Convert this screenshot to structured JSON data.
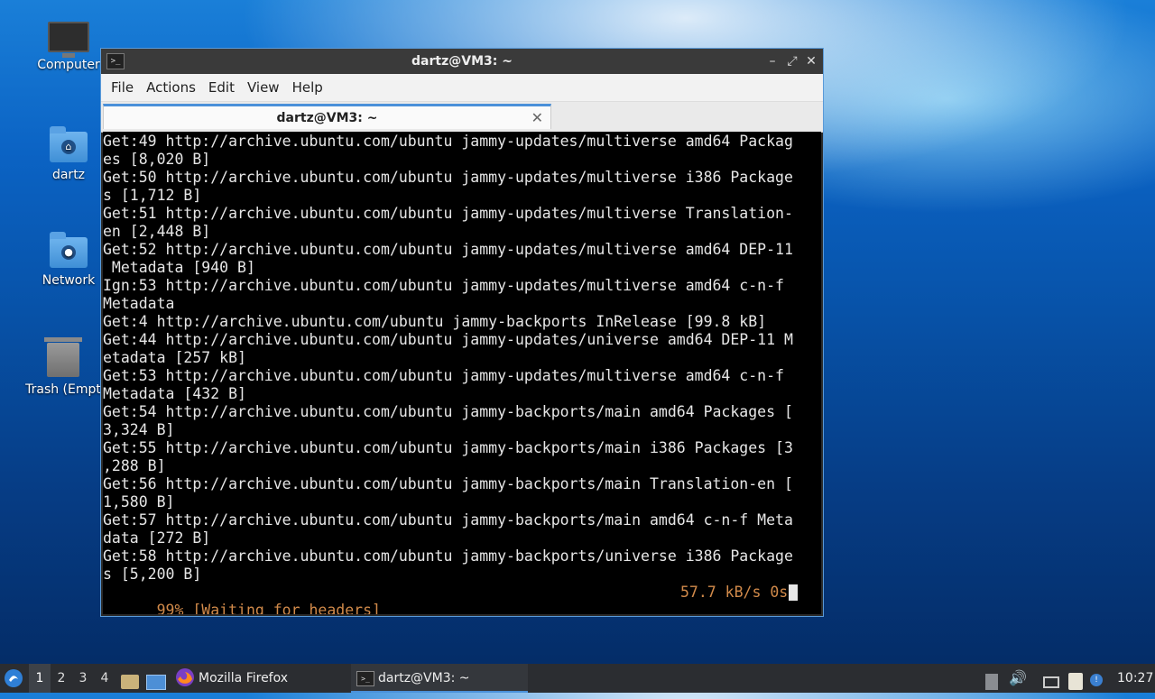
{
  "desktop": {
    "icons": [
      {
        "label": "Computer"
      },
      {
        "label": "dartz"
      },
      {
        "label": "Network"
      },
      {
        "label": "Trash (Empt"
      }
    ]
  },
  "window": {
    "title": "dartz@VM3: ~",
    "menu": [
      "File",
      "Actions",
      "Edit",
      "View",
      "Help"
    ],
    "tab_title": "dartz@VM3: ~",
    "controls": {
      "minimize": "–",
      "maximize": "⤢",
      "close": "✕"
    }
  },
  "terminal": {
    "lines": [
      "Get:49 http://archive.ubuntu.com/ubuntu jammy-updates/multiverse amd64 Packag",
      "es [8,020 B]",
      "Get:50 http://archive.ubuntu.com/ubuntu jammy-updates/multiverse i386 Package",
      "s [1,712 B]",
      "Get:51 http://archive.ubuntu.com/ubuntu jammy-updates/multiverse Translation-",
      "en [2,448 B]",
      "Get:52 http://archive.ubuntu.com/ubuntu jammy-updates/multiverse amd64 DEP-11",
      " Metadata [940 B]",
      "Ign:53 http://archive.ubuntu.com/ubuntu jammy-updates/multiverse amd64 c-n-f",
      "Metadata",
      "Get:4 http://archive.ubuntu.com/ubuntu jammy-backports InRelease [99.8 kB]",
      "Get:44 http://archive.ubuntu.com/ubuntu jammy-updates/universe amd64 DEP-11 M",
      "etadata [257 kB]",
      "Get:53 http://archive.ubuntu.com/ubuntu jammy-updates/multiverse amd64 c-n-f",
      "Metadata [432 B]",
      "Get:54 http://archive.ubuntu.com/ubuntu jammy-backports/main amd64 Packages [",
      "3,324 B]",
      "Get:55 http://archive.ubuntu.com/ubuntu jammy-backports/main i386 Packages [3",
      ",288 B]",
      "Get:56 http://archive.ubuntu.com/ubuntu jammy-backports/main Translation-en [",
      "1,580 B]",
      "Get:57 http://archive.ubuntu.com/ubuntu jammy-backports/main amd64 c-n-f Meta",
      "data [272 B]",
      "Get:58 http://archive.ubuntu.com/ubuntu jammy-backports/universe i386 Package",
      "s [5,200 B]"
    ],
    "status_left": "99% [Waiting for headers]",
    "status_right": "57.7 kB/s 0s",
    "status_color": "#d18a4a"
  },
  "taskbar": {
    "workspaces": [
      "1",
      "2",
      "3",
      "4"
    ],
    "tasks": [
      {
        "label": "Mozilla Firefox",
        "icon": "firefox-icon"
      },
      {
        "label": "dartz@VM3: ~",
        "icon": "terminal-icon"
      }
    ],
    "clock": "10:27"
  }
}
